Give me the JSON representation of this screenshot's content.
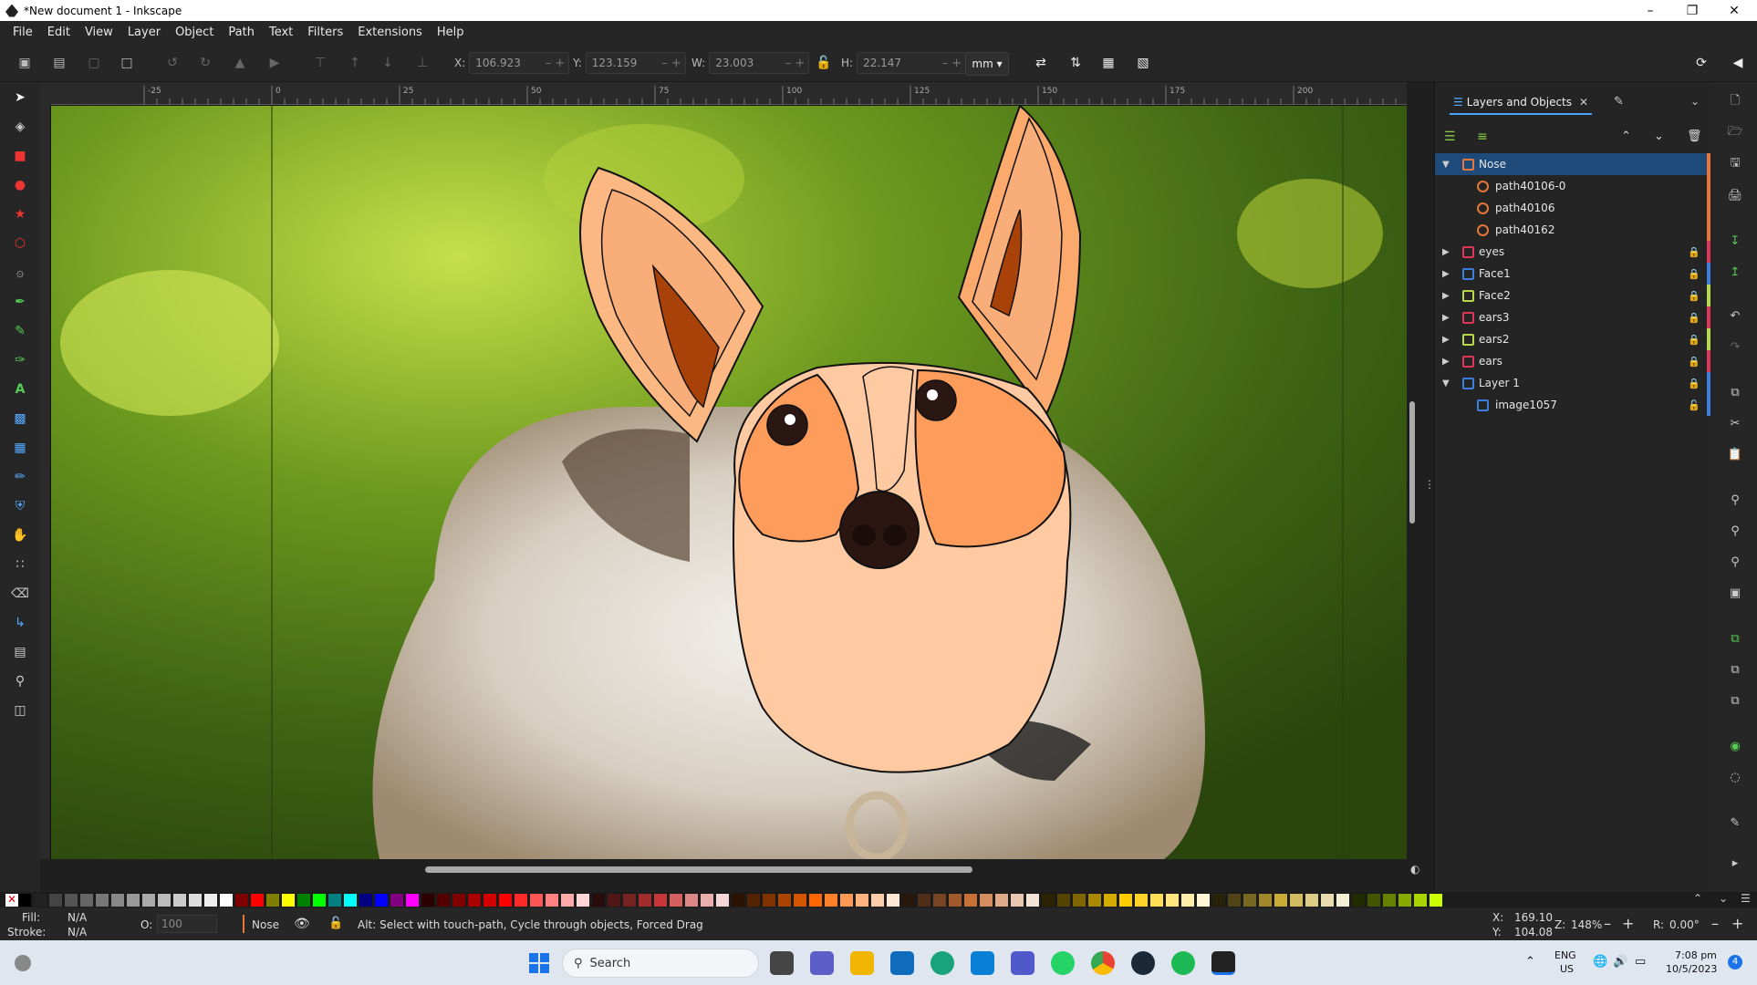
{
  "window": {
    "title": "*New document 1 - Inkscape"
  },
  "menu": [
    "File",
    "Edit",
    "View",
    "Layer",
    "Object",
    "Path",
    "Text",
    "Filters",
    "Extensions",
    "Help"
  ],
  "toolbar": {
    "x_label": "X:",
    "x_value": "106.923",
    "y_label": "Y:",
    "y_value": "123.159",
    "w_label": "W:",
    "w_value": "23.003",
    "h_label": "H:",
    "h_value": "22.147",
    "unit": "mm"
  },
  "ruler_ticks": [
    "-25",
    "0",
    "25",
    "50",
    "75",
    "100",
    "125",
    "150",
    "175",
    "200"
  ],
  "panel": {
    "tab_label": "Layers and Objects",
    "tree": [
      {
        "name": "Nose",
        "expanded": true,
        "selected": true,
        "color": "#e8763a",
        "locked": false
      },
      {
        "name": "path40106-0",
        "child": true,
        "color": "#e8763a"
      },
      {
        "name": "path40106",
        "child": true,
        "color": "#e8763a"
      },
      {
        "name": "path40162",
        "child": true,
        "color": "#e8763a"
      },
      {
        "name": "eyes",
        "expanded": false,
        "color": "#e0365a",
        "locked": true
      },
      {
        "name": "Face1",
        "expanded": false,
        "color": "#3b7fe0",
        "locked": true
      },
      {
        "name": "Face2",
        "expanded": false,
        "color": "#b8d84a",
        "locked": true
      },
      {
        "name": "ears3",
        "expanded": false,
        "color": "#e0365a",
        "locked": true
      },
      {
        "name": "ears2",
        "expanded": false,
        "color": "#b8d84a",
        "locked": true
      },
      {
        "name": "ears",
        "expanded": false,
        "color": "#e0365a",
        "locked": true
      },
      {
        "name": "Layer 1",
        "expanded": true,
        "color": "#3b7fe0",
        "locked": true
      },
      {
        "name": "image1057",
        "child": true,
        "color": "#3b7fe0"
      }
    ]
  },
  "status": {
    "fill_label": "Fill:",
    "fill_value": "N/A",
    "stroke_label": "Stroke:",
    "stroke_value": "N/A",
    "opacity_label": "O:",
    "opacity_value": "100",
    "layer_name": "Nose",
    "message": "Alt: Select with touch-path, Cycle through objects, Forced Drag",
    "cx_label": "X:",
    "cx_value": "169.10",
    "cy_label": "Y:",
    "cy_value": "104.08",
    "zoom_label": "Z:",
    "zoom_value": "148%",
    "rot_label": "R:",
    "rot_value": "0.00°"
  },
  "taskbar": {
    "search_placeholder": "Search",
    "lang1": "ENG",
    "lang2": "US",
    "time": "7:08 pm",
    "date": "10/5/2023",
    "badge": "4"
  },
  "colors": {
    "accent": "#4aa0ff",
    "selected_row": "#1e4a7a",
    "nose_color": "#e8763a"
  }
}
